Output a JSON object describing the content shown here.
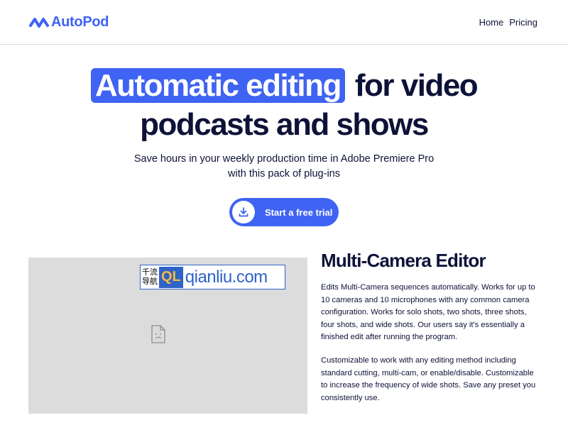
{
  "header": {
    "brand": "AutoPod",
    "nav": [
      "Home",
      "Pricing"
    ]
  },
  "hero": {
    "highlight": "Automatic editing",
    "title_rest": "for video",
    "title_line2": "podcasts and shows",
    "subtitle_line1": "Save hours in your weekly production time in Adobe Premiere Pro",
    "subtitle_line2": "with this pack of plug-ins",
    "cta_label": "Start a free trial"
  },
  "watermark": {
    "cn_top": "千流",
    "cn_bottom": "导航",
    "badge": "QL",
    "url": "qianliu.com"
  },
  "feature": {
    "title": "Multi-Camera Editor",
    "paragraph1": "Edits Multi-Camera sequences automatically.  Works for up to 10 cameras and 10 microphones with any common camera configuration. Works for solo shots, two shots, three shots, four shots, and wide shots. Our users say it's essentially a finished edit after running the program.",
    "paragraph2": "Customizable to work with any editing method including standard cutting, multi-cam, or enable/disable.  Customizable to increase the frequency of wide shots.  Save any preset you consistently use."
  },
  "colors": {
    "accent": "#3f63f2",
    "text": "#0d1238",
    "media_placeholder": "#dcdcdc"
  },
  "icons": {
    "logo": "wave-logo-icon",
    "cta": "download-icon",
    "media": "broken-image-icon"
  }
}
